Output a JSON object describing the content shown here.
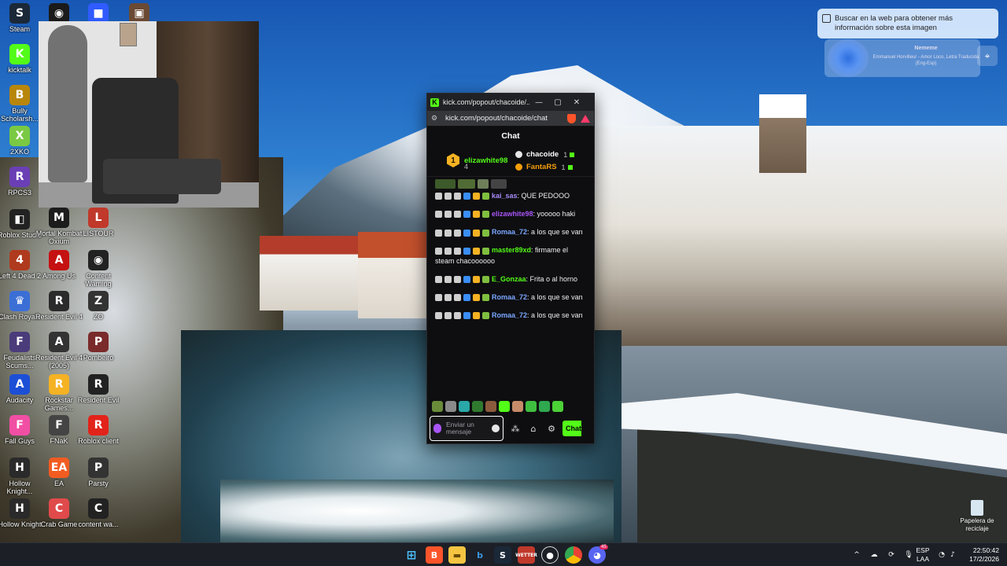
{
  "desktop_icons": [
    {
      "label": "Steam",
      "color": "#1b2838",
      "glyph": "S"
    },
    {
      "label": "",
      "color": "#1a1a1a",
      "glyph": "◉"
    },
    {
      "label": "",
      "color": "#2f5bff",
      "glyph": "■"
    },
    {
      "label": "",
      "color": "#6b4a34",
      "glyph": "▣"
    },
    {
      "label": "kicktalk",
      "color": "#53fc18",
      "glyph": "K"
    },
    {
      "label": "Bully Scholarsh...",
      "color": "#b8860b",
      "glyph": "B"
    },
    {
      "label": "2XKO",
      "color": "#7ac943",
      "glyph": "X"
    },
    {
      "label": "RPCS3",
      "color": "#6a3fb5",
      "glyph": "R"
    },
    {
      "label": "Roblox Studio",
      "color": "#222",
      "glyph": "◧"
    },
    {
      "label": "Left 4 Dead 2",
      "color": "#b03a1e",
      "glyph": "4"
    },
    {
      "label": "Clash Royale",
      "color": "#3b6fd6",
      "glyph": "♛"
    },
    {
      "label": "Feudalists Scums...",
      "color": "#4a3b7a",
      "glyph": "F"
    },
    {
      "label": "Audacity",
      "color": "#1c4fd6",
      "glyph": "A"
    },
    {
      "label": "Fall Guys",
      "color": "#f14fa4",
      "glyph": "F"
    },
    {
      "label": "Hollow Knight...",
      "color": "#2a2a2a",
      "glyph": "H"
    },
    {
      "label": "Hollow Knight",
      "color": "#2a2a2a",
      "glyph": "H"
    },
    {
      "label": "Mortal Kombat Oxium",
      "color": "#1c1c1c",
      "glyph": "M"
    },
    {
      "label": "Among Us",
      "color": "#c51111",
      "glyph": "A"
    },
    {
      "label": "Resident Evil 4",
      "color": "#2b2b2b",
      "glyph": "R"
    },
    {
      "label": "Resident Evil 4 (2005)",
      "color": "#333",
      "glyph": "A"
    },
    {
      "label": "Rockstar Games...",
      "color": "#f5b223",
      "glyph": "R"
    },
    {
      "label": "FNaK",
      "color": "#444",
      "glyph": "F"
    },
    {
      "label": "EA",
      "color": "#f25c21",
      "glyph": "EA"
    },
    {
      "label": "Crab Game",
      "color": "#e04a4a",
      "glyph": "C"
    },
    {
      "label": "LISTOUR",
      "color": "#c0392b",
      "glyph": "L"
    },
    {
      "label": "Content Warning",
      "color": "#222",
      "glyph": "◉"
    },
    {
      "label": "ZO",
      "color": "#333",
      "glyph": "Z"
    },
    {
      "label": "Pombeiro",
      "color": "#7a2a2a",
      "glyph": "P"
    },
    {
      "label": "Resident Evil",
      "color": "#222",
      "glyph": "R"
    },
    {
      "label": "Roblox client",
      "color": "#e2231a",
      "glyph": "R"
    },
    {
      "label": "Parsty",
      "color": "#333",
      "glyph": "P"
    },
    {
      "label": "content wa...",
      "color": "#222",
      "glyph": "C"
    }
  ],
  "popup": {
    "window_title": "kick.com/popout/chacoide/...",
    "minimize": "—",
    "maximize": "▢",
    "close": "✕",
    "url": "kick.com/popout/chacoide/chat",
    "header": "Chat",
    "leaderboard": {
      "first_name": "elizawhite98",
      "first_badge": "1",
      "first_count": "4",
      "second_name": "chacoide",
      "second_count": "1",
      "third_name": "FantaRS",
      "third_count": "1"
    },
    "messages": [
      {
        "user": "kai_sas",
        "user_color": "#a78bfa",
        "text": ": QUE PEDOOO"
      },
      {
        "user": "elizawhite98",
        "user_color": "#a855f7",
        "text": ": yooooo haki"
      },
      {
        "user": "Romaa_72",
        "user_color": "#7aa7ff",
        "text": ": a los que se van"
      },
      {
        "user": "master89xd",
        "user_color": "#53fc18",
        "text": ": firmame el steam chacoooooo"
      },
      {
        "user": "E_Gonzaa",
        "user_color": "#53fc18",
        "text": ": Frita o al horno"
      },
      {
        "user": "Romaa_72",
        "user_color": "#7aa7ff",
        "text": ": a los que se van"
      },
      {
        "user": "Romaa_72",
        "user_color": "#7aa7ff",
        "text": ": a los que se van"
      }
    ],
    "input_placeholder": "Enviar un mensaje",
    "send_label": "Chat"
  },
  "lens": {
    "text": "Buscar en la web para obtener más información sobre esta imagen",
    "media_artist": "Nememe",
    "media_song": "Emmanuel Horvilleur - Amor Loco, Letra Traducida (Eng-Esp)"
  },
  "recycle_bin": "Papelera de reciclaje",
  "taskbar": {
    "lang_top": "ESP",
    "lang_bottom": "LAA",
    "time": "22:50:42",
    "date": "17/2/2026",
    "discord_badge": "45",
    "wetter_label": "WETTER"
  }
}
